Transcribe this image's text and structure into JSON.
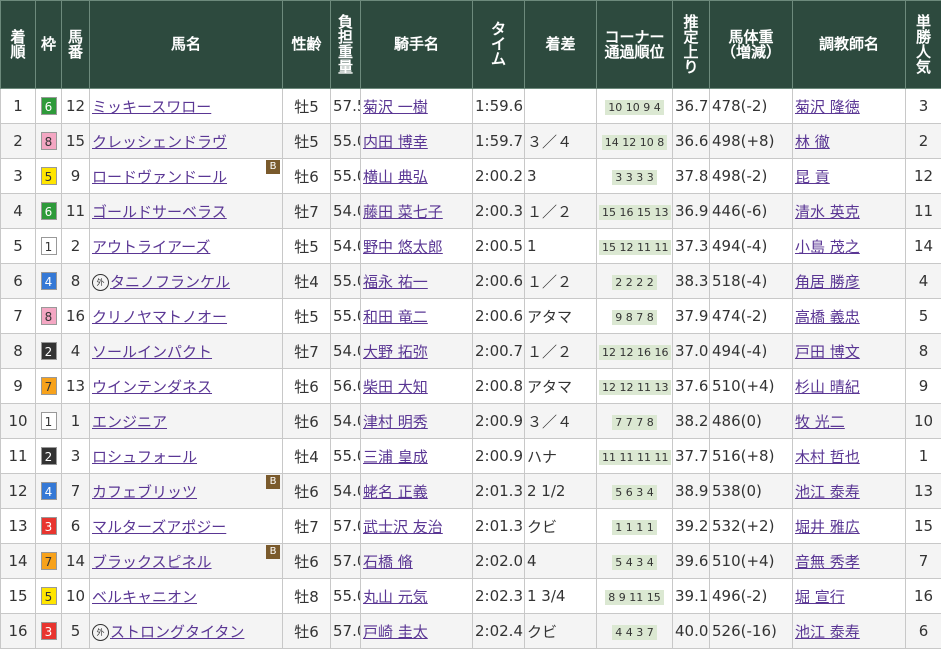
{
  "headers": {
    "rank": "着\n順",
    "waku": "枠",
    "umaban": "馬\n番",
    "name": "馬名",
    "sexage": "性齢",
    "weight": "負\n担\n重\n量",
    "jockey": "騎手名",
    "time": "タ\nイ\nム",
    "margin": "着差",
    "corner": "コーナー\n通過順位",
    "last3f": "推\n定\n上\nり",
    "bodyweight": "馬体重\n（増減）",
    "trainer": "調教師名",
    "popularity": "単\n勝\n人\n気"
  },
  "colors": {
    "header_bg": "#2d4a3e",
    "link": "#5a3694",
    "waku": {
      "1": {
        "bg": "#ffffff",
        "fg": "#333333"
      },
      "2": {
        "bg": "#333333",
        "fg": "#ffffff"
      },
      "3": {
        "bg": "#e8352f",
        "fg": "#ffffff"
      },
      "4": {
        "bg": "#3579d6",
        "fg": "#ffffff"
      },
      "5": {
        "bg": "#ffe500",
        "fg": "#333333"
      },
      "6": {
        "bg": "#2e9a3a",
        "fg": "#ffffff"
      },
      "7": {
        "bg": "#f7a21b",
        "fg": "#333333"
      },
      "8": {
        "bg": "#f4a7c3",
        "fg": "#333333"
      }
    }
  },
  "rows": [
    {
      "rank": "1",
      "waku": "6",
      "umaban": "12",
      "name": "ミッキースワロー",
      "prefix": "",
      "blinker": false,
      "sexage": "牡5",
      "weight": "57.5",
      "jockey": "菊沢 一樹",
      "time": "1:59.6",
      "margin": "",
      "corner": "10 10 9 4",
      "last3f": "36.7",
      "bodyweight": "478(-2)",
      "trainer": "菊沢 隆徳",
      "popularity": "3"
    },
    {
      "rank": "2",
      "waku": "8",
      "umaban": "15",
      "name": "クレッシェンドラヴ",
      "prefix": "",
      "blinker": false,
      "sexage": "牡5",
      "weight": "55.0",
      "jockey": "内田 博幸",
      "time": "1:59.7",
      "margin": "３／４",
      "corner": "14 12 10 8",
      "last3f": "36.6",
      "bodyweight": "498(+8)",
      "trainer": "林 徹",
      "popularity": "2"
    },
    {
      "rank": "3",
      "waku": "5",
      "umaban": "9",
      "name": "ロードヴァンドール",
      "prefix": "",
      "blinker": true,
      "sexage": "牡6",
      "weight": "55.0",
      "jockey": "横山 典弘",
      "time": "2:00.2",
      "margin": "3",
      "corner": "3 3 3 3",
      "last3f": "37.8",
      "bodyweight": "498(-2)",
      "trainer": "昆 貢",
      "popularity": "12"
    },
    {
      "rank": "4",
      "waku": "6",
      "umaban": "11",
      "name": "ゴールドサーベラス",
      "prefix": "",
      "blinker": false,
      "sexage": "牡7",
      "weight": "54.0",
      "jockey": "藤田 菜七子",
      "time": "2:00.3",
      "margin": "１／２",
      "corner": "15 16 15 13",
      "last3f": "36.9",
      "bodyweight": "446(-6)",
      "trainer": "清水 英克",
      "popularity": "11"
    },
    {
      "rank": "5",
      "waku": "1",
      "umaban": "2",
      "name": "アウトライアーズ",
      "prefix": "",
      "blinker": false,
      "sexage": "牡5",
      "weight": "54.0",
      "jockey": "野中 悠太郎",
      "time": "2:00.5",
      "margin": "1",
      "corner": "15 12 11 11",
      "last3f": "37.3",
      "bodyweight": "494(-4)",
      "trainer": "小島 茂之",
      "popularity": "14"
    },
    {
      "rank": "6",
      "waku": "4",
      "umaban": "8",
      "name": "タニノフランケル",
      "prefix": "外",
      "blinker": false,
      "sexage": "牡4",
      "weight": "55.0",
      "jockey": "福永 祐一",
      "time": "2:00.6",
      "margin": "１／２",
      "corner": "2 2 2 2",
      "last3f": "38.3",
      "bodyweight": "518(-4)",
      "trainer": "角居 勝彦",
      "popularity": "4"
    },
    {
      "rank": "7",
      "waku": "8",
      "umaban": "16",
      "name": "クリノヤマトノオー",
      "prefix": "",
      "blinker": false,
      "sexage": "牡5",
      "weight": "55.0",
      "jockey": "和田 竜二",
      "time": "2:00.6",
      "margin": "アタマ",
      "corner": "9 8 7 8",
      "last3f": "37.9",
      "bodyweight": "474(-2)",
      "trainer": "高橋 義忠",
      "popularity": "5"
    },
    {
      "rank": "8",
      "waku": "2",
      "umaban": "4",
      "name": "ソールインパクト",
      "prefix": "",
      "blinker": false,
      "sexage": "牡7",
      "weight": "54.0",
      "jockey": "大野 拓弥",
      "time": "2:00.7",
      "margin": "１／２",
      "corner": "12 12 16 16",
      "last3f": "37.0",
      "bodyweight": "494(-4)",
      "trainer": "戸田 博文",
      "popularity": "8"
    },
    {
      "rank": "9",
      "waku": "7",
      "umaban": "13",
      "name": "ウインテンダネス",
      "prefix": "",
      "blinker": false,
      "sexage": "牡6",
      "weight": "56.0",
      "jockey": "柴田 大知",
      "time": "2:00.8",
      "margin": "アタマ",
      "corner": "12 12 11 13",
      "last3f": "37.6",
      "bodyweight": "510(+4)",
      "trainer": "杉山 晴紀",
      "popularity": "9"
    },
    {
      "rank": "10",
      "waku": "1",
      "umaban": "1",
      "name": "エンジニア",
      "prefix": "",
      "blinker": false,
      "sexage": "牡6",
      "weight": "54.0",
      "jockey": "津村 明秀",
      "time": "2:00.9",
      "margin": "３／４",
      "corner": "7 7 7 8",
      "last3f": "38.2",
      "bodyweight": "486(0)",
      "trainer": "牧 光二",
      "popularity": "10"
    },
    {
      "rank": "11",
      "waku": "2",
      "umaban": "3",
      "name": "ロシュフォール",
      "prefix": "",
      "blinker": false,
      "sexage": "牡4",
      "weight": "55.0",
      "jockey": "三浦 皇成",
      "time": "2:00.9",
      "margin": "ハナ",
      "corner": "11 11 11 11",
      "last3f": "37.7",
      "bodyweight": "516(+8)",
      "trainer": "木村 哲也",
      "popularity": "1"
    },
    {
      "rank": "12",
      "waku": "4",
      "umaban": "7",
      "name": "カフェブリッツ",
      "prefix": "",
      "blinker": true,
      "sexage": "牡6",
      "weight": "54.0",
      "jockey": "蛯名 正義",
      "time": "2:01.3",
      "margin": "2 1/2",
      "corner": "5 6 3 4",
      "last3f": "38.9",
      "bodyweight": "538(0)",
      "trainer": "池江 泰寿",
      "popularity": "13"
    },
    {
      "rank": "13",
      "waku": "3",
      "umaban": "6",
      "name": "マルターズアポジー",
      "prefix": "",
      "blinker": false,
      "sexage": "牡7",
      "weight": "57.0",
      "jockey": "武士沢 友治",
      "time": "2:01.3",
      "margin": "クビ",
      "corner": "1 1 1 1",
      "last3f": "39.2",
      "bodyweight": "532(+2)",
      "trainer": "堀井 雅広",
      "popularity": "15"
    },
    {
      "rank": "14",
      "waku": "7",
      "umaban": "14",
      "name": "ブラックスピネル",
      "prefix": "",
      "blinker": true,
      "sexage": "牡6",
      "weight": "57.0",
      "jockey": "石橋 脩",
      "time": "2:02.0",
      "margin": "4",
      "corner": "5 4 3 4",
      "last3f": "39.6",
      "bodyweight": "510(+4)",
      "trainer": "音無 秀孝",
      "popularity": "7"
    },
    {
      "rank": "15",
      "waku": "5",
      "umaban": "10",
      "name": "ベルキャニオン",
      "prefix": "",
      "blinker": false,
      "sexage": "牡8",
      "weight": "55.0",
      "jockey": "丸山 元気",
      "time": "2:02.3",
      "margin": "1 3/4",
      "corner": "8 9 11 15",
      "last3f": "39.1",
      "bodyweight": "496(-2)",
      "trainer": "堀 宣行",
      "popularity": "16"
    },
    {
      "rank": "16",
      "waku": "3",
      "umaban": "5",
      "name": "ストロングタイタン",
      "prefix": "外",
      "blinker": false,
      "sexage": "牡6",
      "weight": "57.0",
      "jockey": "戸崎 圭太",
      "time": "2:02.4",
      "margin": "クビ",
      "corner": "4 4 3 7",
      "last3f": "40.0",
      "bodyweight": "526(-16)",
      "trainer": "池江 泰寿",
      "popularity": "6"
    }
  ]
}
